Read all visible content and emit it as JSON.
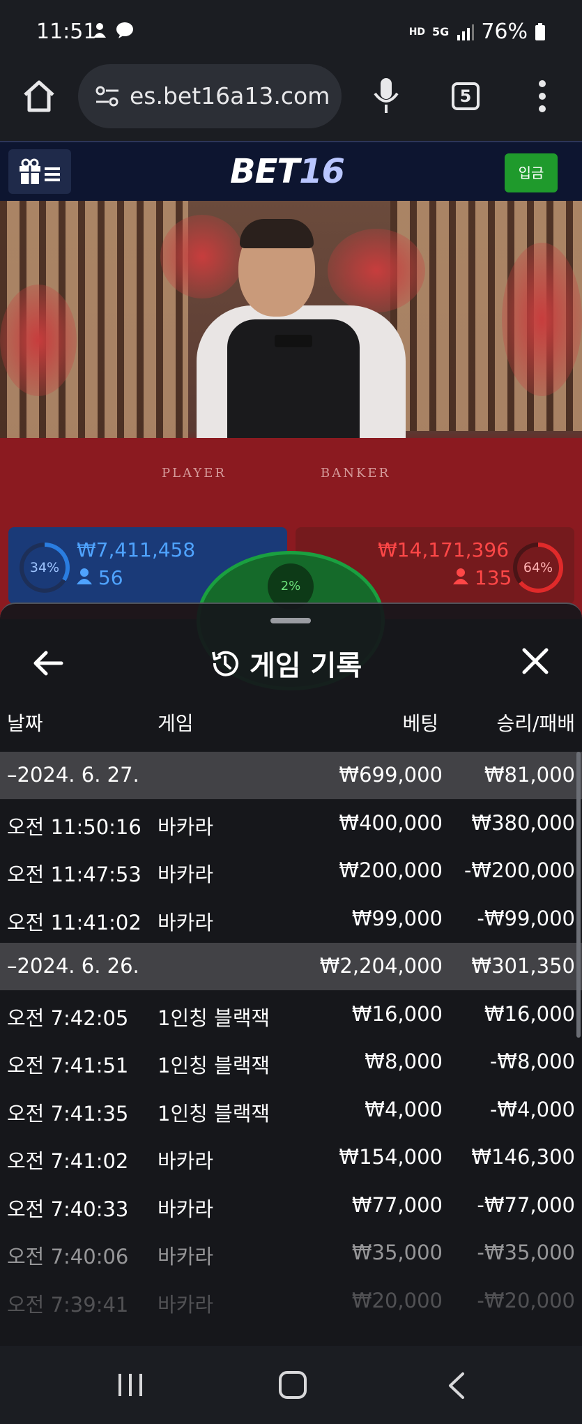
{
  "status_bar": {
    "time": "11:51",
    "battery": "76%",
    "network": "5G",
    "hd_voice": "HD"
  },
  "browser": {
    "url": "es.bet16a13.com",
    "tab_count": "5"
  },
  "site": {
    "logo_bet": "BET",
    "logo_num": "16",
    "deposit_label": "입금"
  },
  "video": {
    "table_player": "PLAYER",
    "table_banker": "BANKER"
  },
  "bets": {
    "player_pct": "34%",
    "player_amount": "₩7,411,458",
    "player_count": "56",
    "tie_pct": "2%",
    "banker_pct": "64%",
    "banker_amount": "₩14,171,396",
    "banker_count": "135"
  },
  "sheet": {
    "title": "게임 기록",
    "columns": {
      "date": "날짜",
      "game": "게임",
      "bet": "베팅",
      "result": "승리/패배"
    },
    "rows": [
      {
        "type": "group",
        "date": "–2024. 6. 27.",
        "game": "",
        "bet": "₩699,000",
        "result": "₩81,000"
      },
      {
        "type": "item",
        "date": "오전 11:50:16",
        "game": "바카라",
        "bet": "₩400,000",
        "result": "₩380,000"
      },
      {
        "type": "item",
        "date": "오전 11:47:53",
        "game": "바카라",
        "bet": "₩200,000",
        "result": "-₩200,000"
      },
      {
        "type": "item",
        "date": "오전 11:41:02",
        "game": "바카라",
        "bet": "₩99,000",
        "result": "-₩99,000"
      },
      {
        "type": "group",
        "date": "–2024. 6. 26.",
        "game": "",
        "bet": "₩2,204,000",
        "result": "₩301,350"
      },
      {
        "type": "item",
        "date": "오전 7:42:05",
        "game": "1인칭 블랙잭",
        "bet": "₩16,000",
        "result": "₩16,000"
      },
      {
        "type": "item",
        "date": "오전 7:41:51",
        "game": "1인칭 블랙잭",
        "bet": "₩8,000",
        "result": "-₩8,000"
      },
      {
        "type": "item",
        "date": "오전 7:41:35",
        "game": "1인칭 블랙잭",
        "bet": "₩4,000",
        "result": "-₩4,000"
      },
      {
        "type": "item",
        "date": "오전 7:41:02",
        "game": "바카라",
        "bet": "₩154,000",
        "result": "₩146,300"
      },
      {
        "type": "item",
        "date": "오전 7:40:33",
        "game": "바카라",
        "bet": "₩77,000",
        "result": "-₩77,000"
      },
      {
        "type": "item",
        "date": "오전 7:40:06",
        "game": "바카라",
        "bet": "₩35,000",
        "result": "-₩35,000"
      },
      {
        "type": "item",
        "date": "오전 7:39:41",
        "game": "바카라",
        "bet": "₩20,000",
        "result": "-₩20,000"
      }
    ]
  },
  "icons": {
    "home": "home-icon",
    "tune": "tune-icon",
    "mic": "mic-icon",
    "menu": "more-vert-icon",
    "gift": "gift-icon",
    "history": "history-icon",
    "back": "arrow-left-icon",
    "close": "close-icon"
  },
  "colors": {
    "player": "#1a3a78",
    "banker": "#751a1d",
    "tie": "#156a2a",
    "deposit": "#1f9a2c",
    "site_header": "#0d1530"
  }
}
